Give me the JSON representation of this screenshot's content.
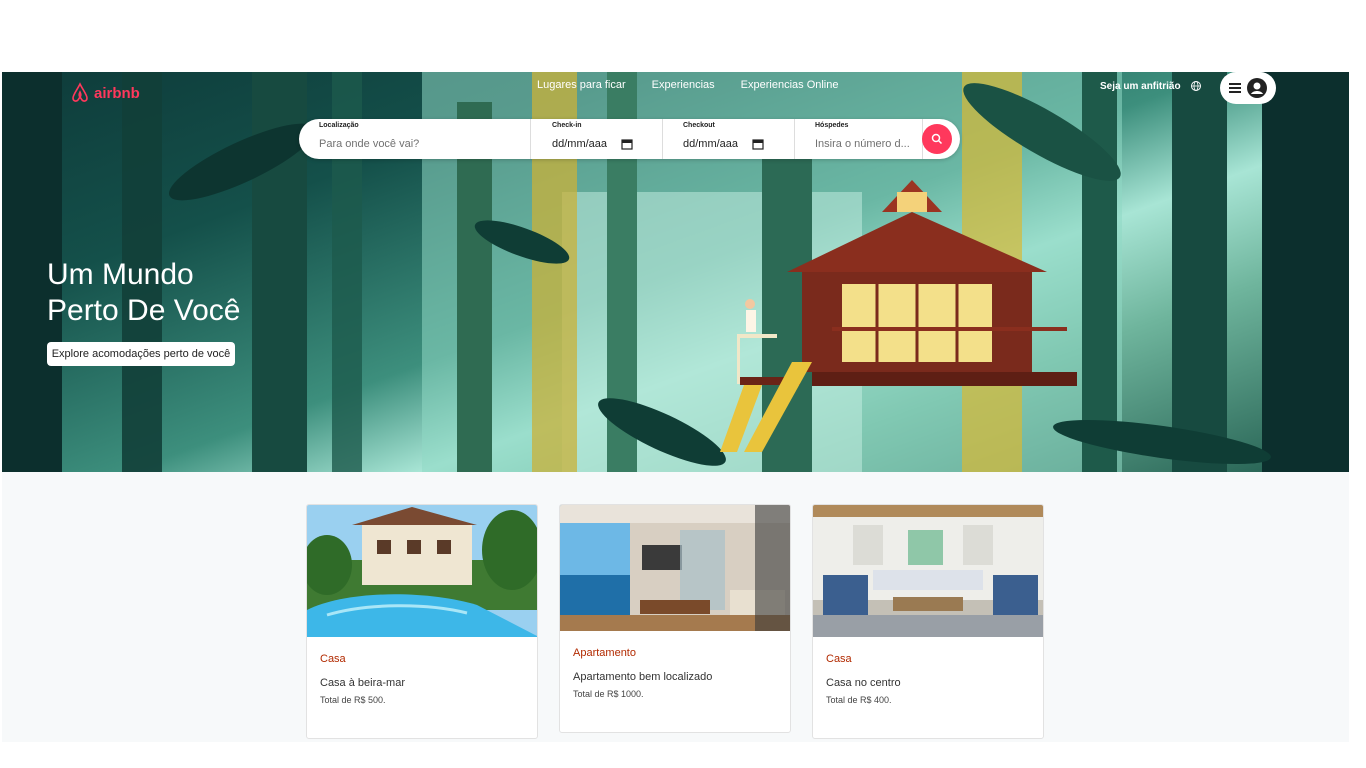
{
  "header": {
    "brand": "airbnb",
    "nav": [
      "Lugares para ficar",
      "Experiencias",
      "Experiencias Online"
    ],
    "host_link": "Seja um anfitrião",
    "icons": {
      "globe": "globe-icon",
      "menu": "hamburger-menu-icon",
      "user": "user-circle-icon"
    }
  },
  "search": {
    "location": {
      "label": "Localização",
      "placeholder": "Para onde você vai?"
    },
    "checkin": {
      "label": "Check-in",
      "value": "dd/mm/aaa"
    },
    "checkout": {
      "label": "Checkout",
      "value": "dd/mm/aaa"
    },
    "guests": {
      "label": "Hóspedes",
      "placeholder": "Insira o número d..."
    },
    "button_icon": "search-icon"
  },
  "hero": {
    "title_line1": "Um Mundo",
    "title_line2": "Perto De Você",
    "cta": "Explore acomodações perto de você"
  },
  "listings": [
    {
      "category": "Casa",
      "title": "Casa à beira-mar",
      "price": "Total de R$ 500."
    },
    {
      "category": "Apartamento",
      "title": "Apartamento bem localizado",
      "price": "Total de R$ 1000."
    },
    {
      "category": "Casa",
      "title": "Casa no centro",
      "price": "Total de R$ 400."
    }
  ],
  "colors": {
    "brand": "#ff385c",
    "category": "#b22a00",
    "hero_dark": "#0e3b3a",
    "hero_light": "#a8e5d5"
  }
}
